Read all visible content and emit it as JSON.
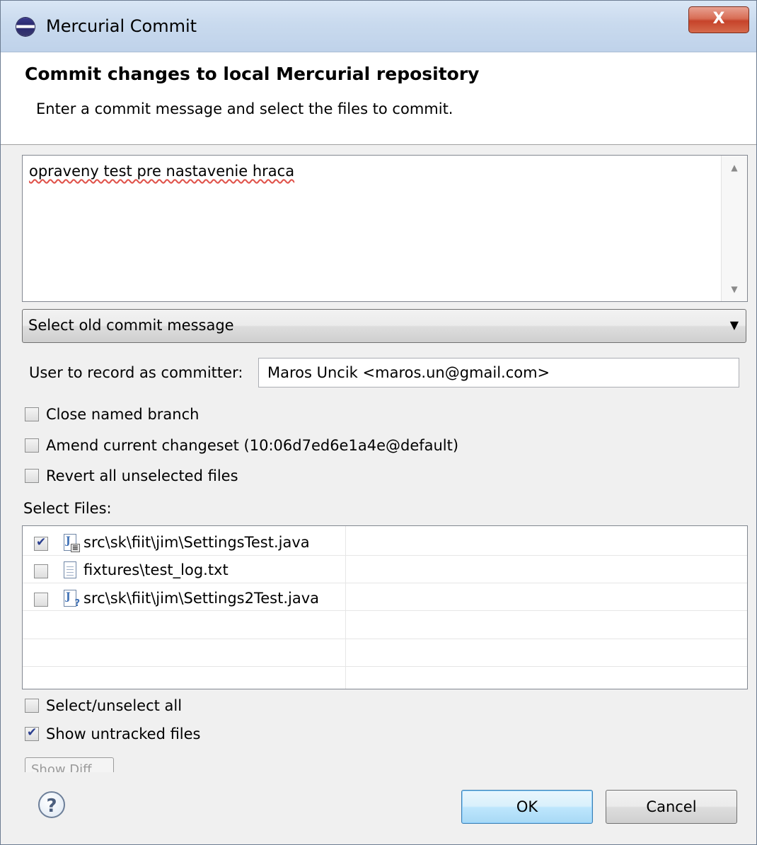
{
  "window": {
    "title": "Mercurial Commit",
    "close_glyph": "X",
    "app_icon": "eclipse-icon"
  },
  "header": {
    "title": "Commit changes to local Mercurial repository",
    "description": "Enter a commit message and select the files to commit."
  },
  "message": {
    "value": "opraveny test pre nastavenie hraca"
  },
  "old_message_combo": {
    "value": "Select old commit message"
  },
  "committer": {
    "label": "User to record as committer:",
    "value": "Maros Uncik <maros.un@gmail.com>"
  },
  "options": [
    {
      "label": "Close named branch",
      "checked": false
    },
    {
      "label": "Amend current changeset (10:06d7ed6e1a4e@default)",
      "checked": false
    },
    {
      "label": "Revert all unselected files",
      "checked": false
    }
  ],
  "files_label": "Select Files:",
  "files": [
    {
      "name": "src\\sk\\fiit\\jim\\SettingsTest.java",
      "checked": true,
      "icon": "java-file-modified-icon"
    },
    {
      "name": "fixtures\\test_log.txt",
      "checked": false,
      "icon": "text-file-icon"
    },
    {
      "name": "src\\sk\\fiit\\jim\\Settings2Test.java",
      "checked": false,
      "icon": "java-file-untracked-icon"
    }
  ],
  "select_all": {
    "label": "Select/unselect all",
    "checked": false
  },
  "show_untracked": {
    "label": "Show untracked files",
    "checked": true
  },
  "show_diff": {
    "label": "Show Diff"
  },
  "buttons": {
    "ok": "OK",
    "cancel": "Cancel"
  }
}
